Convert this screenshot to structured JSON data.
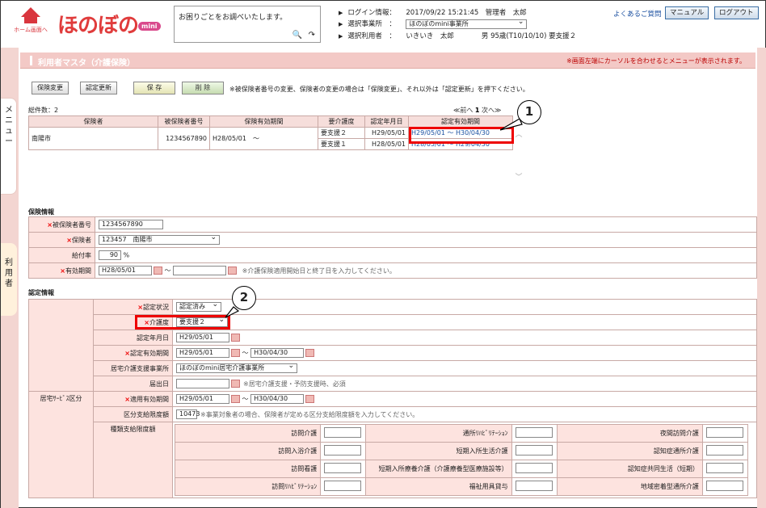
{
  "header": {
    "home_label": "ホーム画面へ",
    "brand": "ほのぼの",
    "brand_mini": "mini",
    "search_placeholder": "お困りごとをお調べいたします。",
    "login_key": "ログイン情報：",
    "login_value": "2017/09/22 15:21:45　管理者　太郎",
    "office_key": "選択事業所　：",
    "office_value": "ほのぼのmini事業所",
    "user_key": "選択利用者　：",
    "user_value": "いきいき　太郎　　　　男 95歳(T10/10/10) 要支援２",
    "faq": "よくあるご質問",
    "manual": "マニュアル",
    "logout": "ログアウト"
  },
  "side": {
    "menu": "メニュー",
    "user": "利用者"
  },
  "title": {
    "text": "利用者マスタ（介護保険）",
    "hint": "※画面左端にカーソルを合わせるとメニューが表示されます。"
  },
  "toolbar": {
    "insurance_change": "保険変更",
    "cert_update": "認定更新",
    "save": "保 存",
    "delete": "削 除",
    "note": "※被保険者番号の変更、保険者の変更の場合は「保険変更」、それ以外は「認定更新」を押下ください。"
  },
  "list": {
    "total": "総件数：2",
    "pager_prev": "≪前へ",
    "pager_page": "1",
    "pager_next": "次へ≫",
    "headers": [
      "保険者",
      "被保険者番号",
      "保険有効期間",
      "要介護度",
      "認定年月日",
      "認定有効期間"
    ],
    "insurer": "南陽市",
    "insured_no": "1234567890",
    "validity": "H28/05/01　～",
    "rows": [
      {
        "level": "要支援２",
        "cert_date": "H29/05/01",
        "cert_period": "H29/05/01 ～ H30/04/30"
      },
      {
        "level": "要支援１",
        "cert_date": "H28/05/01",
        "cert_period": "H28/05/01 ～ H29/04/30"
      }
    ]
  },
  "callouts": {
    "one": "1",
    "two": "2"
  },
  "insurance": {
    "section": "保険情報",
    "insured_no_label": "被保険者番号",
    "insured_no": "1234567890",
    "insurer_label": "保険者",
    "insurer": "123457　南陽市",
    "benefit_label": "給付率",
    "benefit": "90",
    "benefit_unit": "%",
    "period_label": "有効期間",
    "period_from": "H28/05/01",
    "period_to": "",
    "tilde": "～",
    "period_note": "※介護保険適用開始日と終了日を入力してください。"
  },
  "cert": {
    "section": "認定情報",
    "status_label": "認定状況",
    "status": "認定済み",
    "level_label": "介護度",
    "level": "要支援２",
    "date_label": "認定年月日",
    "date": "H29/05/01",
    "period_label": "認定有効期間",
    "period_from": "H29/05/01",
    "period_to": "H30/04/30",
    "tilde": "～",
    "office_label": "居宅介護支援事業所",
    "office": "ほのぼのmini居宅介護事業所",
    "notify_label": "届出日",
    "notify": "",
    "notify_note": "※居宅介護支援・予防支援時、必須",
    "svc_group_label": "居宅ｻｰﾋﾞｽ区分",
    "svc_period_label": "適用有効期間",
    "svc_from": "H29/05/01",
    "svc_to": "H30/04/30",
    "limit_label": "区分支給限度額",
    "limit": "10473",
    "limit_note": "※事業対象者の場合、保険者が定める区分支給限度額を入力してください。",
    "type_limit_label": "種類支給限度額",
    "services": [
      [
        "訪問介護",
        "通所ﾘﾊﾋﾞﾘﾃｰｼｮﾝ",
        "夜間訪問介護"
      ],
      [
        "訪問入浴介護",
        "短期入所生活介護",
        "認知症通所介護"
      ],
      [
        "訪問看護",
        "短期入所療養介護（介護療養型医療施設等）",
        "認知症共同生活（短期）"
      ],
      [
        "訪問ﾘﾊﾋﾞﾘﾃｰｼｮﾝ",
        "福祉用具貸与",
        "地域密着型通所介護"
      ]
    ]
  }
}
